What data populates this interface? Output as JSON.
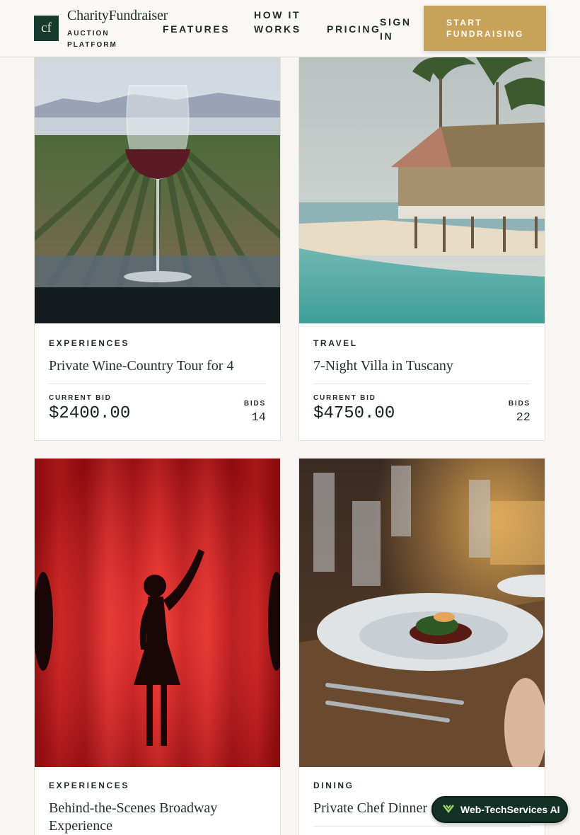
{
  "header": {
    "logo": "cf",
    "brand": "CharityFundraiser",
    "brand_sub": "AUCTION PLATFORM",
    "nav": [
      "FEATURES",
      "HOW IT WORKS",
      "PRICING",
      "SIGN IN"
    ],
    "cta": "START FUNDRAISING"
  },
  "cards": [
    {
      "category": "EXPERIENCES",
      "title": "Private Wine-Country Tour for 4",
      "bid_label": "CURRENT BID",
      "bid": "$2400.00",
      "bids_label": "BIDS",
      "bids": "14"
    },
    {
      "category": "TRAVEL",
      "title": "7-Night Villa in Tuscany",
      "bid_label": "CURRENT BID",
      "bid": "$4750.00",
      "bids_label": "BIDS",
      "bids": "22"
    },
    {
      "category": "EXPERIENCES",
      "title": "Behind-the-Scenes Broadway Experience"
    },
    {
      "category": "DINING",
      "title": "Private Chef Dinner f"
    }
  ],
  "badge": {
    "label": "Web-TechServices AI"
  },
  "colors": {
    "brand_green": "#173a2e",
    "accent_gold": "#c9a25a",
    "background": "#f7f6f2"
  }
}
